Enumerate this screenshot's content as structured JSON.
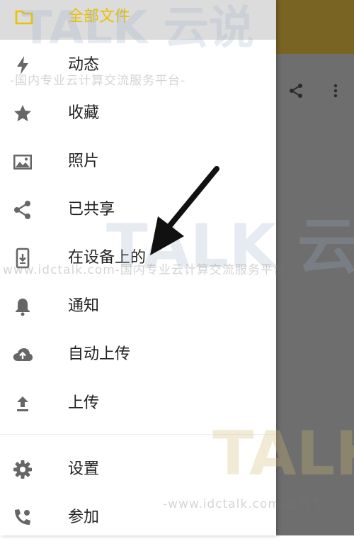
{
  "drawer": {
    "header": {
      "label": "全部文件",
      "icon": "folder-icon"
    },
    "items": [
      {
        "id": "activity",
        "label": "动态",
        "icon": "lightning-icon"
      },
      {
        "id": "favorites",
        "label": "收藏",
        "icon": "star-icon"
      },
      {
        "id": "photos",
        "label": "照片",
        "icon": "image-icon"
      },
      {
        "id": "shared",
        "label": "已共享",
        "icon": "share-icon"
      },
      {
        "id": "on-device",
        "label": "在设备上的",
        "icon": "phone-download-icon"
      },
      {
        "id": "notifications",
        "label": "通知",
        "icon": "bell-icon"
      },
      {
        "id": "auto-upload",
        "label": "自动上传",
        "icon": "cloud-upload-icon"
      },
      {
        "id": "upload",
        "label": "上传",
        "icon": "upload-icon"
      },
      {
        "id": "settings",
        "label": "设置",
        "icon": "gear-icon"
      },
      {
        "id": "join",
        "label": "参加",
        "icon": "contact-phone-icon"
      }
    ]
  },
  "watermark": {
    "brand_1": "TALK 云说",
    "text_1": "-国内专业云计算交流服务平台-",
    "brand_2": "TALK 云说",
    "text_2": "www.idctalk.com-国内专业云计算交流服务平台",
    "brand_3": "TALK",
    "text_3": "-www.idctalk.com-国内专"
  },
  "colors": {
    "accent": "#e9c200",
    "toolbar": "#7a6424",
    "scrim": "#6e6e6e",
    "icon": "#666666"
  }
}
